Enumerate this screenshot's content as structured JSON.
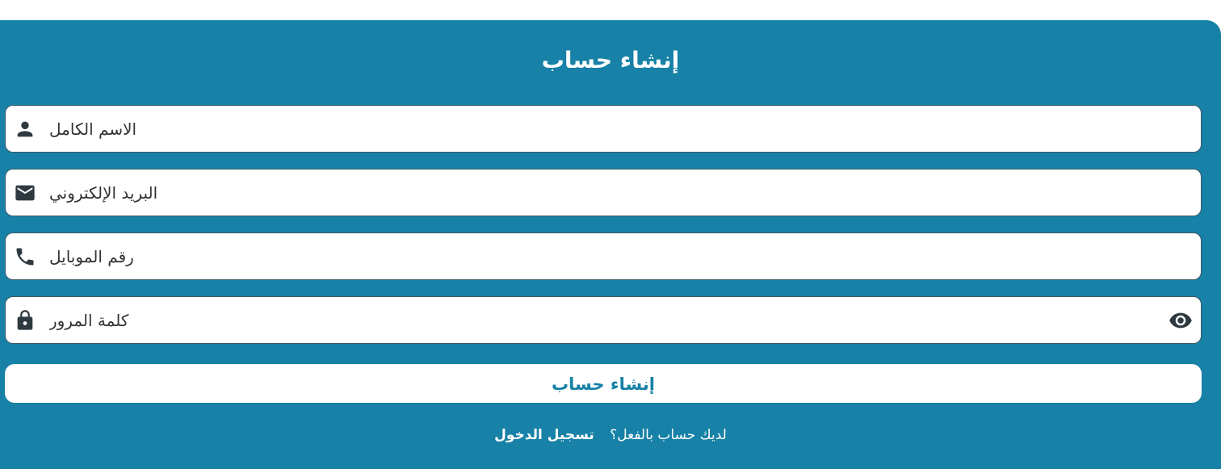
{
  "form": {
    "title": "إنشاء حساب",
    "fields": [
      {
        "icon": "person-icon",
        "placeholder": "الاسم الكامل"
      },
      {
        "icon": "envelope-icon",
        "placeholder": "البريد الإلكتروني"
      },
      {
        "icon": "phone-icon",
        "placeholder": "رقم الموبايل"
      },
      {
        "icon": "lock-icon",
        "placeholder": "كلمة المرور",
        "toggle_icon": "eye-icon"
      }
    ],
    "submit_label": "إنشاء حساب",
    "footer": {
      "question": "لديك حساب بالفعل؟",
      "login_link": "تسجيل الدخول"
    }
  },
  "colors": {
    "card_background": "#1781a7",
    "field_background": "#ffffff",
    "field_border": "#3d5966",
    "icon_color": "#2f3a40",
    "submit_text": "#1781a7"
  }
}
